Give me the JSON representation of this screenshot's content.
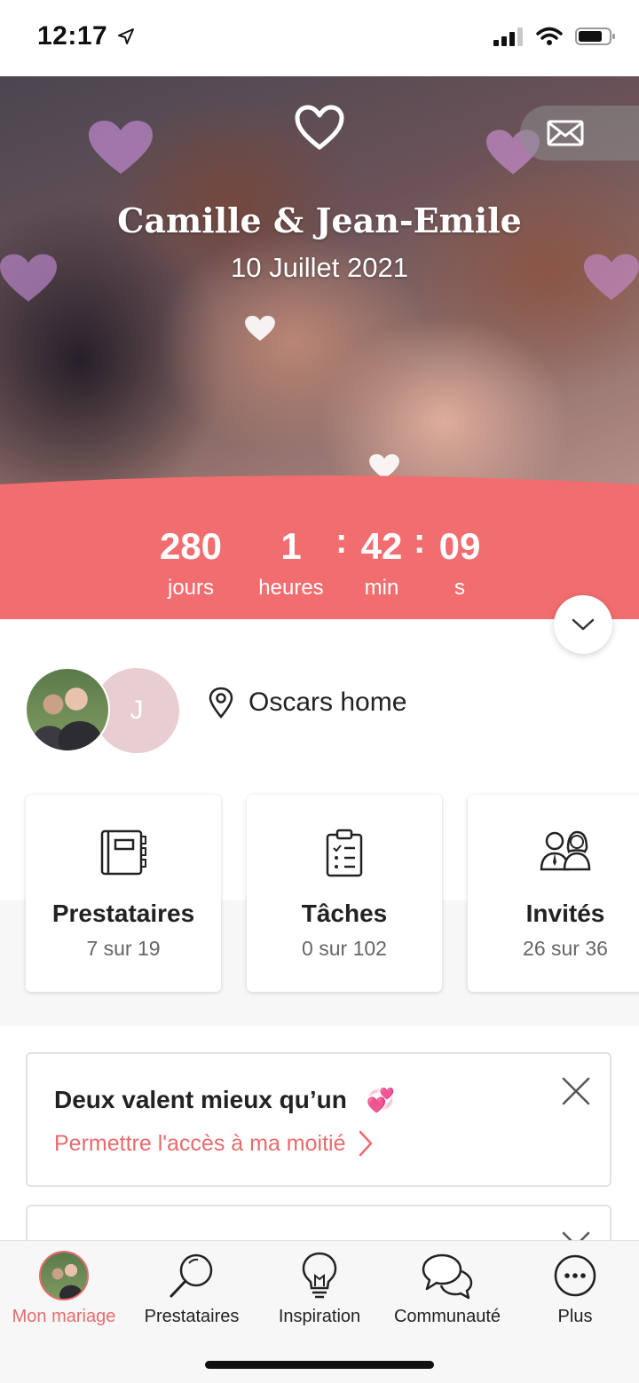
{
  "status_bar": {
    "time": "12:17"
  },
  "hero": {
    "names": "Camille & Jean-Emile",
    "date": "10 Juillet 2021"
  },
  "countdown": {
    "days": {
      "value": "280",
      "label": "jours"
    },
    "hours": {
      "value": "1",
      "label": "heures"
    },
    "minutes": {
      "value": "42",
      "label": "min"
    },
    "seconds": {
      "value": "09",
      "label": "s"
    },
    "separator": ":"
  },
  "couple": {
    "partner_initial": "J",
    "location": "Oscars home"
  },
  "cards": [
    {
      "title": "Prestataires",
      "subtitle": "7 sur 19",
      "icon": "notebook-icon"
    },
    {
      "title": "Tâches",
      "subtitle": "0 sur 102",
      "icon": "checklist-icon"
    },
    {
      "title": "Invités",
      "subtitle": "26 sur 36",
      "icon": "guests-icon"
    }
  ],
  "banner": {
    "title": "Deux valent mieux qu’un",
    "emoji": "💞",
    "link": "Permettre l'accès à ma moitié"
  },
  "tab_bar": {
    "items": [
      {
        "label": "Mon mariage",
        "icon": "avatar",
        "active": true
      },
      {
        "label": "Prestataires",
        "icon": "search-icon",
        "active": false
      },
      {
        "label": "Inspiration",
        "icon": "lightbulb-icon",
        "active": false
      },
      {
        "label": "Communauté",
        "icon": "chat-bubbles-icon",
        "active": false
      },
      {
        "label": "Plus",
        "icon": "more-icon",
        "active": false
      }
    ]
  },
  "colors": {
    "accent": "#F26D6F",
    "link": "#E86B6D",
    "avatar_placeholder": "#E8CDD1"
  }
}
